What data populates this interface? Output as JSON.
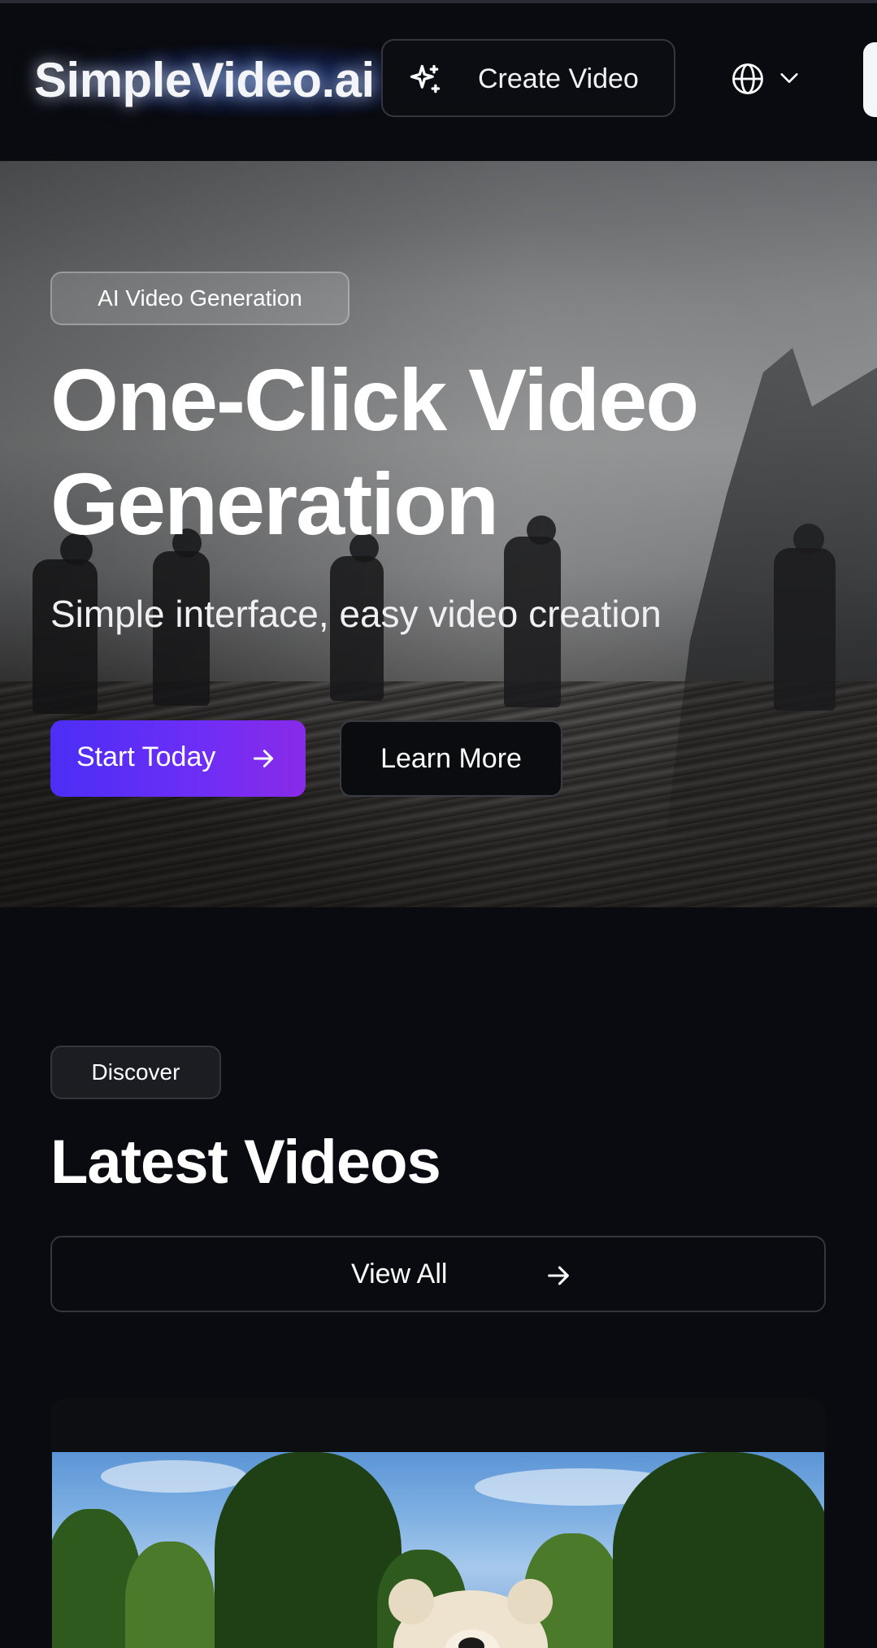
{
  "header": {
    "logo": "SimpleVideo.ai",
    "create_video_label": "Create Video",
    "language_icon": "globe-icon",
    "language_menu_icon": "chevron-down-icon",
    "create_icon": "sparkles-icon"
  },
  "hero": {
    "badge": "AI Video Generation",
    "title": "One-Click Video Generation",
    "subtitle": "Simple interface, easy video creation",
    "primary_button": "Start Today",
    "secondary_button": "Learn More"
  },
  "latest": {
    "badge": "Discover",
    "title": "Latest Videos",
    "view_all_label": "View All"
  },
  "colors": {
    "background": "#0a0b10",
    "primary_gradient_start": "#4b2ef5",
    "primary_gradient_end": "#8a2ae8",
    "border": "#34363e"
  }
}
